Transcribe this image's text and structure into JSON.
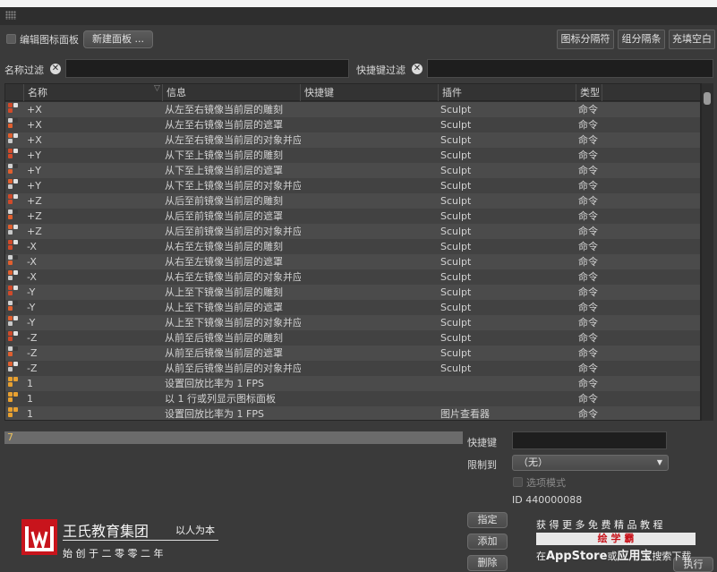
{
  "toolbar": {
    "edit_label": "编辑图标面板",
    "new_panel": "新建面板 ...",
    "separator": "图标分隔符",
    "group_separator": "组分隔条",
    "fill_blank": "充填空白"
  },
  "filters": {
    "name_label": "名称过滤",
    "shortcut_label": "快捷键过滤"
  },
  "columns": [
    "名称",
    "信息",
    "快捷键",
    "插件",
    "类型"
  ],
  "rows": [
    {
      "name": "+X",
      "info": "从左至右镜像当前层的雕刻",
      "plugin": "Sculpt",
      "type": "命令",
      "icon": "sculpt"
    },
    {
      "name": "+X",
      "info": "从左至右镜像当前层的遮罩",
      "plugin": "Sculpt",
      "type": "命令",
      "icon": "mask"
    },
    {
      "name": "+X",
      "info": "从左至右镜像当前层的对象并应",
      "plugin": "Sculpt",
      "type": "命令",
      "icon": "obj"
    },
    {
      "name": "+Y",
      "info": "从下至上镜像当前层的雕刻",
      "plugin": "Sculpt",
      "type": "命令",
      "icon": "sculpt"
    },
    {
      "name": "+Y",
      "info": "从下至上镜像当前层的遮罩",
      "plugin": "Sculpt",
      "type": "命令",
      "icon": "mask"
    },
    {
      "name": "+Y",
      "info": "从下至上镜像当前层的对象并应",
      "plugin": "Sculpt",
      "type": "命令",
      "icon": "obj"
    },
    {
      "name": "+Z",
      "info": "从后至前镜像当前层的雕刻",
      "plugin": "Sculpt",
      "type": "命令",
      "icon": "sculpt"
    },
    {
      "name": "+Z",
      "info": "从后至前镜像当前层的遮罩",
      "plugin": "Sculpt",
      "type": "命令",
      "icon": "mask"
    },
    {
      "name": "+Z",
      "info": "从后至前镜像当前层的对象并应",
      "plugin": "Sculpt",
      "type": "命令",
      "icon": "obj"
    },
    {
      "name": "-X",
      "info": "从右至左镜像当前层的雕刻",
      "plugin": "Sculpt",
      "type": "命令",
      "icon": "sculpt"
    },
    {
      "name": "-X",
      "info": "从右至左镜像当前层的遮罩",
      "plugin": "Sculpt",
      "type": "命令",
      "icon": "mask"
    },
    {
      "name": "-X",
      "info": "从右至左镜像当前层的对象并应",
      "plugin": "Sculpt",
      "type": "命令",
      "icon": "obj"
    },
    {
      "name": "-Y",
      "info": "从上至下镜像当前层的雕刻",
      "plugin": "Sculpt",
      "type": "命令",
      "icon": "sculpt"
    },
    {
      "name": "-Y",
      "info": "从上至下镜像当前层的遮罩",
      "plugin": "Sculpt",
      "type": "命令",
      "icon": "mask"
    },
    {
      "name": "-Y",
      "info": "从上至下镜像当前层的对象并应",
      "plugin": "Sculpt",
      "type": "命令",
      "icon": "obj"
    },
    {
      "name": "-Z",
      "info": "从前至后镜像当前层的雕刻",
      "plugin": "Sculpt",
      "type": "命令",
      "icon": "sculpt"
    },
    {
      "name": "-Z",
      "info": "从前至后镜像当前层的遮罩",
      "plugin": "Sculpt",
      "type": "命令",
      "icon": "mask"
    },
    {
      "name": "-Z",
      "info": "从前至后镜像当前层的对象并应",
      "plugin": "Sculpt",
      "type": "命令",
      "icon": "obj"
    },
    {
      "name": "1",
      "info": "设置回放比率为 1 FPS",
      "plugin": "",
      "type": "命令",
      "icon": "fps"
    },
    {
      "name": "1",
      "info": "以 1 行或列显示图标面板",
      "plugin": "",
      "type": "命令",
      "icon": "line"
    },
    {
      "name": "1",
      "info": "设置回放比率为 1 FPS",
      "plugin": "图片查看器",
      "type": "命令",
      "icon": "fps"
    }
  ],
  "selection": {
    "value": "7"
  },
  "details": {
    "shortcut_label": "快捷键",
    "limit_label": "限制到",
    "limit_value": "（无）",
    "option_mode": "选项模式",
    "id_text": "ID 440000088"
  },
  "side_buttons": {
    "assign": "指定",
    "add": "添加",
    "delete": "删除",
    "execute": "执行"
  },
  "watermark": {
    "brand": "王氏教育集团",
    "motto": "以人为本",
    "since": "始 创 于 二 零 零 二 年",
    "promo": "获 得 更 多 免 费 精 品 教 程",
    "promo_badge": "绘 学 霸",
    "promo_bottom_pre": "在",
    "promo_store": "AppStore",
    "promo_or": "或",
    "promo_app": "应用宝",
    "promo_tail": "搜索下载"
  },
  "colors": {
    "accent": "#e8c060",
    "brand_red": "#c8141c"
  }
}
